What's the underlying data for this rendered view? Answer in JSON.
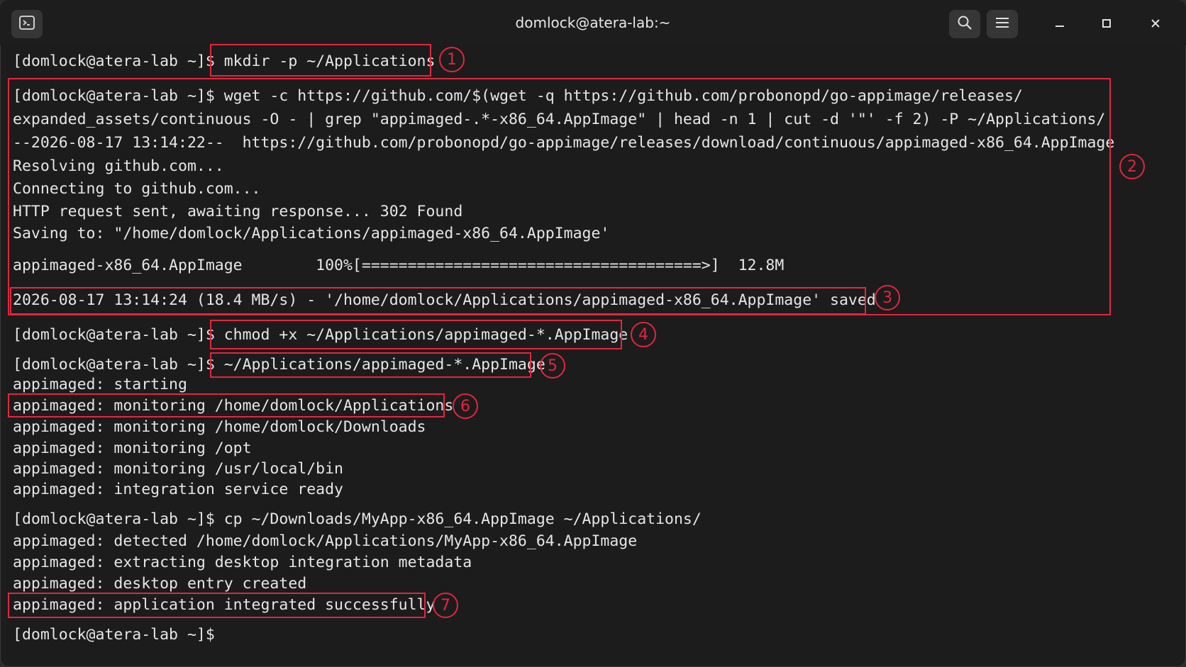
{
  "window": {
    "title": "domlock@atera-lab:~"
  },
  "terminal": {
    "lines": [
      "[domlock@atera-lab ~]$ mkdir -p ~/Applications",
      "[domlock@atera-lab ~]$ wget -c https://github.com/$(wget -q https://github.com/probonopd/go-appimage/releases/",
      "expanded_assets/continuous -O - | grep \"appimaged-.*-x86_64.AppImage\" | head -n 1 | cut -d '\"' -f 2) -P ~/Applications/",
      "--2026-08-17 13:14:22--  https://github.com/probonopd/go-appimage/releases/download/continuous/appimaged-x86_64.AppImage",
      "Resolving github.com...",
      "Connecting to github.com...",
      "HTTP request sent, awaiting response... 302 Found",
      "Saving to: \"/home/domlock/Applications/appimaged-x86_64.AppImage'",
      "appimaged-x86_64.AppImage        100%[=====================================>]  12.8M",
      "2026-08-17 13:14:24 (18.4 MB/s) - '/home/domlock/Applications/appimaged-x86_64.AppImage' saved",
      "[domlock@atera-lab ~]$ chmod +x ~/Applications/appimaged-*.AppImage",
      "[domlock@atera-lab ~]$ ~/Applications/appimaged-*.AppImage",
      "appimaged: starting",
      "appimaged: monitoring /home/domlock/Applications",
      "appimaged: monitoring /home/domlock/Downloads",
      "appimaged: monitoring /opt",
      "appimaged: monitoring /usr/local/bin",
      "appimaged: integration service ready",
      "[domlock@atera-lab ~]$ cp ~/Downloads/MyApp-x86_64.AppImage ~/Applications/",
      "appimaged: detected /home/domlock/Applications/MyApp-x86_64.AppImage",
      "appimaged: extracting desktop integration metadata",
      "appimaged: desktop entry created",
      "appimaged: application integrated successfully",
      "[domlock@atera-lab ~]$"
    ]
  },
  "annotations": {
    "badges": [
      "1",
      "2",
      "3",
      "4",
      "5",
      "6",
      "7"
    ],
    "color": "#e2263f"
  },
  "icons": {
    "terminal": "terminal-icon",
    "search": "search-icon",
    "menu": "hamburger-menu-icon",
    "minimize": "minimize-icon",
    "maximize": "maximize-icon",
    "close": "close-icon"
  }
}
